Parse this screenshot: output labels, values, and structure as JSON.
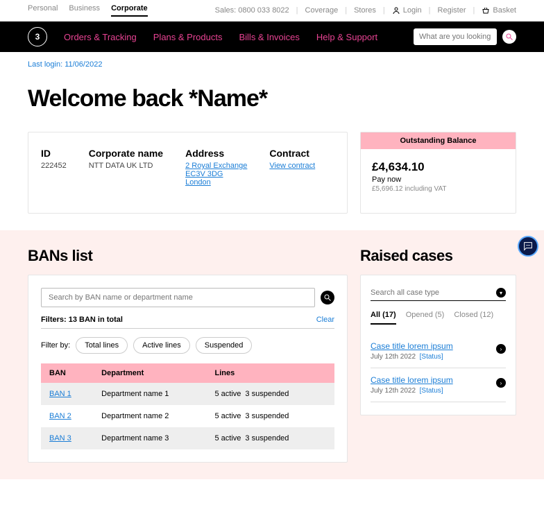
{
  "topbar": {
    "segments": [
      "Personal",
      "Business",
      "Corporate"
    ],
    "active_segment": 2,
    "sales": "Sales: 0800 033 8022",
    "links": {
      "coverage": "Coverage",
      "stores": "Stores",
      "login": "Login",
      "register": "Register",
      "basket": "Basket"
    }
  },
  "nav": {
    "items": [
      "Orders & Tracking",
      "Plans & Products",
      "Bills & Invoices",
      "Help & Support"
    ],
    "search_placeholder": "What are you looking for?"
  },
  "last_login": "Last login: 11/06/2022",
  "welcome": "Welcome back *Name*",
  "account": {
    "id_label": "ID",
    "id": "222452",
    "corp_label": "Corporate name",
    "corp": "NTT DATA UK LTD",
    "addr_label": "Address",
    "addr": [
      "2 Royal Exchange",
      "EC3V 3DG",
      "London"
    ],
    "contract_label": "Contract",
    "contract_link": "View contract"
  },
  "balance": {
    "header": "Outstanding Balance",
    "amount": "£4,634.10",
    "paynow": "Pay now",
    "vat": "£5,696.12 including VAT"
  },
  "bans": {
    "title": "BANs list",
    "search_placeholder": "Search by BAN name or department name",
    "filters_label": "Filters: 13 BAN in total",
    "clear": "Clear",
    "filterby_label": "Filter by:",
    "pills": [
      "Total lines",
      "Active lines",
      "Suspended"
    ],
    "cols": [
      "BAN",
      "Department",
      "Lines"
    ],
    "rows": [
      {
        "ban": "BAN 1",
        "dept": "Department name 1",
        "active": "5 active",
        "susp": "3 suspended"
      },
      {
        "ban": "BAN 2",
        "dept": "Department name 2",
        "active": "5 active",
        "susp": "3 suspended"
      },
      {
        "ban": "BAN 3",
        "dept": "Department name 3",
        "active": "5 active",
        "susp": "3 suspended"
      }
    ]
  },
  "cases": {
    "title": "Raised cases",
    "search_placeholder": "Search all case type",
    "tabs": [
      {
        "label": "All (17)",
        "active": true
      },
      {
        "label": "Opened (5)",
        "active": false
      },
      {
        "label": "Closed (12)",
        "active": false
      }
    ],
    "items": [
      {
        "title": "Case title lorem ipsum",
        "date": "July 12th 2022",
        "status": "[Status]"
      },
      {
        "title": "Case title lorem ipsum",
        "date": "July 12th 2022",
        "status": "[Status]"
      }
    ]
  }
}
